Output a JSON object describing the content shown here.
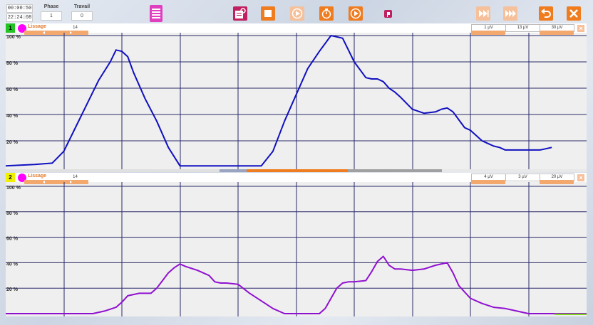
{
  "toolbar": {
    "time_elapsed": "00:00:50",
    "clock": "22:24:08",
    "phase_label": "Phase",
    "phase_value": "1",
    "travail_label": "Travail",
    "travail_value": "0"
  },
  "channels": [
    {
      "number": "1",
      "number_color": "#22c422",
      "lissage_label": "Lissage",
      "lissage_value": "14",
      "scale1": "1 µV",
      "scale2": "13 µV",
      "scale3": "30 µV",
      "line_color": "#1010c0",
      "y_ticks": [
        "100 %",
        "80 %",
        "60 %",
        "40 %",
        "20 %"
      ]
    },
    {
      "number": "2",
      "number_color": "#f0f000",
      "lissage_label": "Lissage",
      "lissage_value": "14",
      "scale1": "4 µV",
      "scale2": "3 µV",
      "scale3": "20 µV",
      "line_color": "#9010d0",
      "y_ticks": [
        "100 %",
        "80 %",
        "60 %",
        "40 %",
        "20 %"
      ]
    }
  ],
  "chart_data": [
    {
      "type": "line",
      "ylim": [
        0,
        100
      ],
      "y_tick_labels": [
        "100 %",
        "80 %",
        "60 %",
        "40 %",
        "20 %"
      ],
      "series": [
        {
          "x": [
            0,
            5,
            8,
            10,
            12,
            14,
            16,
            18,
            19,
            20,
            21,
            22,
            24,
            26,
            28,
            30,
            32,
            34,
            35,
            36,
            38,
            40,
            42,
            44,
            46,
            48,
            50,
            52,
            54,
            56,
            58,
            60,
            62,
            63,
            64,
            65,
            66,
            67,
            68,
            70,
            72,
            74,
            75,
            76,
            77,
            78,
            79,
            80,
            81,
            82,
            83,
            84,
            85,
            86,
            88,
            90,
            92,
            94
          ],
          "values": [
            1,
            2,
            3,
            12,
            30,
            48,
            66,
            80,
            89,
            88,
            84,
            72,
            52,
            35,
            15,
            1,
            1,
            1,
            1,
            1,
            1,
            1,
            1,
            1,
            12,
            35,
            55,
            75,
            88,
            100,
            98,
            80,
            68,
            67,
            67,
            65,
            60,
            57,
            53,
            44,
            41,
            42,
            44,
            45,
            42,
            36,
            30,
            28,
            24,
            20,
            18,
            16,
            15,
            13,
            13,
            13,
            13,
            15
          ]
        }
      ]
    },
    {
      "type": "line",
      "ylim": [
        0,
        100
      ],
      "y_tick_labels": [
        "100 %",
        "80 %",
        "60 %",
        "40 %",
        "20 %"
      ],
      "series": [
        {
          "x": [
            0,
            10,
            15,
            17,
            19,
            20,
            21,
            23,
            25,
            26,
            27,
            28,
            29,
            30,
            31,
            33,
            35,
            36,
            37,
            38,
            40,
            42,
            44,
            46,
            48,
            50,
            52,
            54,
            55,
            56,
            57,
            58,
            59,
            60,
            62,
            63,
            64,
            65,
            66,
            67,
            68,
            70,
            72,
            74,
            76,
            77,
            78,
            80,
            82,
            84,
            86,
            88,
            90,
            92,
            95,
            100
          ],
          "values": [
            0,
            0,
            0,
            2,
            5,
            9,
            14,
            16,
            16,
            20,
            26,
            32,
            36,
            39,
            37,
            34,
            30,
            25,
            24,
            24,
            23,
            16,
            10,
            4,
            0,
            0,
            0,
            0,
            4,
            12,
            20,
            24,
            25,
            25,
            26,
            33,
            41,
            45,
            38,
            35,
            35,
            34,
            35,
            38,
            40,
            32,
            22,
            12,
            8,
            5,
            4,
            2,
            0,
            0,
            0,
            0
          ]
        }
      ]
    }
  ]
}
